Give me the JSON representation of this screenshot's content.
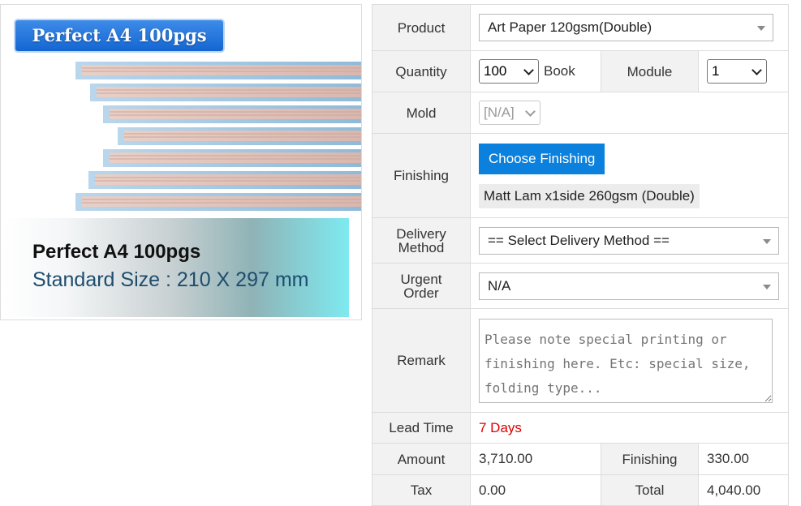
{
  "product_image": {
    "badge_text": "Perfect A4 100pgs",
    "caption_title": "Perfect A4 100pgs",
    "caption_size": "Standard Size : 210 X 297 mm"
  },
  "form": {
    "product": {
      "label": "Product",
      "value": "Art Paper 120gsm(Double)"
    },
    "quantity": {
      "label": "Quantity",
      "value": "100",
      "unit": "Book"
    },
    "module": {
      "label": "Module",
      "value": "1"
    },
    "mold": {
      "label": "Mold",
      "value": "[N/A]"
    },
    "finishing": {
      "label": "Finishing",
      "button_label": "Choose Finishing",
      "selected": "Matt Lam x1side 260gsm (Double)"
    },
    "delivery_method": {
      "label_line1": "Delivery",
      "label_line2": "Method",
      "value": "== Select Delivery Method =="
    },
    "urgent_order": {
      "label_line1": "Urgent",
      "label_line2": "Order",
      "value": "N/A"
    },
    "remark": {
      "label": "Remark",
      "placeholder": "Please note special printing or finishing here. Etc: special size, folding type..."
    },
    "lead_time": {
      "label": "Lead Time",
      "value": "7 Days"
    },
    "amount": {
      "label": "Amount",
      "value": "3,710.00"
    },
    "finishing_cost": {
      "label": "Finishing",
      "value": "330.00"
    },
    "tax": {
      "label": "Tax",
      "value": "0.00"
    },
    "total": {
      "label": "Total",
      "value": "4,040.00"
    }
  },
  "colors": {
    "button_blue": "#0b80dc",
    "lead_time_red": "#e00000",
    "label_bg": "#f2f2f2"
  }
}
